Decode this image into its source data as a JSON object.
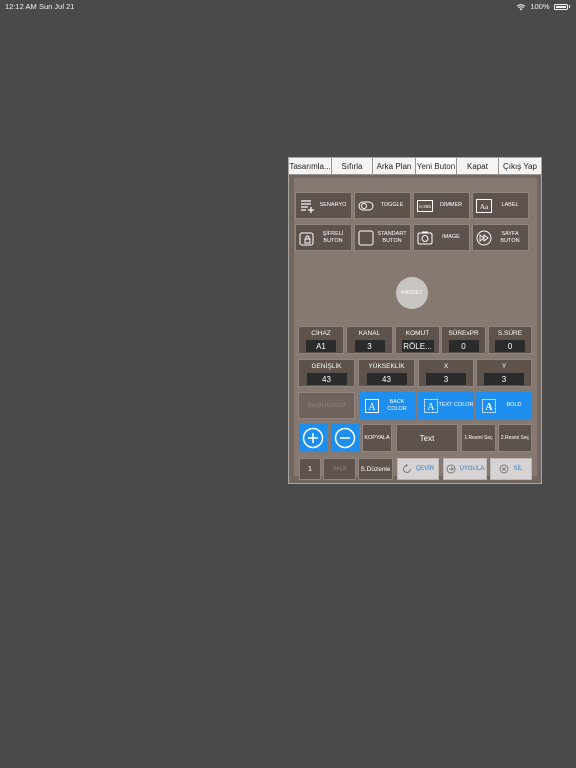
{
  "status": {
    "time": "12:12 AM",
    "date": "Sun Jul 21",
    "battery": "100%"
  },
  "tabs": [
    {
      "label": "Tasarımla..."
    },
    {
      "label": "Sıfırla"
    },
    {
      "label": "Arka Plan"
    },
    {
      "label": "Yeni Buton",
      "active": true
    },
    {
      "label": "Kapat"
    },
    {
      "label": "Çıkış Yap"
    }
  ],
  "tools": {
    "senaryo": "SENARYO",
    "toggle": "TOGGLE",
    "dimmer": "DİMMER",
    "label": "LABEL",
    "sifreli": "ŞİFRELİ BUTON",
    "standart": "STANDART BUTON",
    "image": "IMAGE",
    "sayfa": "SAYFA BUTON",
    "dimmer_icon_text": "0-255",
    "label_icon_text": "Aa"
  },
  "save_label": "KAYDET",
  "fields": {
    "cihaz": {
      "label": "CİHAZ",
      "value": "A1"
    },
    "kanal": {
      "label": "KANAL",
      "value": "3"
    },
    "komut": {
      "label": "KOMUT",
      "value": "RÖLE..."
    },
    "surexpr": {
      "label": "SÜRExPR",
      "value": "0"
    },
    "ssure": {
      "label": "S.SÜRE",
      "value": "0"
    },
    "genislik": {
      "label": "GENİŞLİK",
      "value": "43"
    },
    "yukseklik": {
      "label": "YÜKSEKLİK",
      "value": "43"
    },
    "x": {
      "label": "X",
      "value": "3"
    },
    "y": {
      "label": "Y",
      "value": "3"
    }
  },
  "style_buttons": {
    "disabled": "Seçili Kontrol",
    "back_color": "BACK COLOR",
    "text_color": "TEXT COLOR",
    "bold": "BOLD"
  },
  "row5": {
    "kopyala": "KOPYALA",
    "text": "Text",
    "resim1": "1.Resmi Seç",
    "resim2": "2.Resmi Seç"
  },
  "row6": {
    "number": "1",
    "number_hint": "Seçili",
    "sduzenle": "S.Düzenle",
    "cevir": "ÇEVİR",
    "uygula": "UYGULA",
    "sil": "SİL"
  },
  "colors": {
    "accent": "#1e8fee",
    "panel": "#726660",
    "background": "#4a4a4a"
  }
}
